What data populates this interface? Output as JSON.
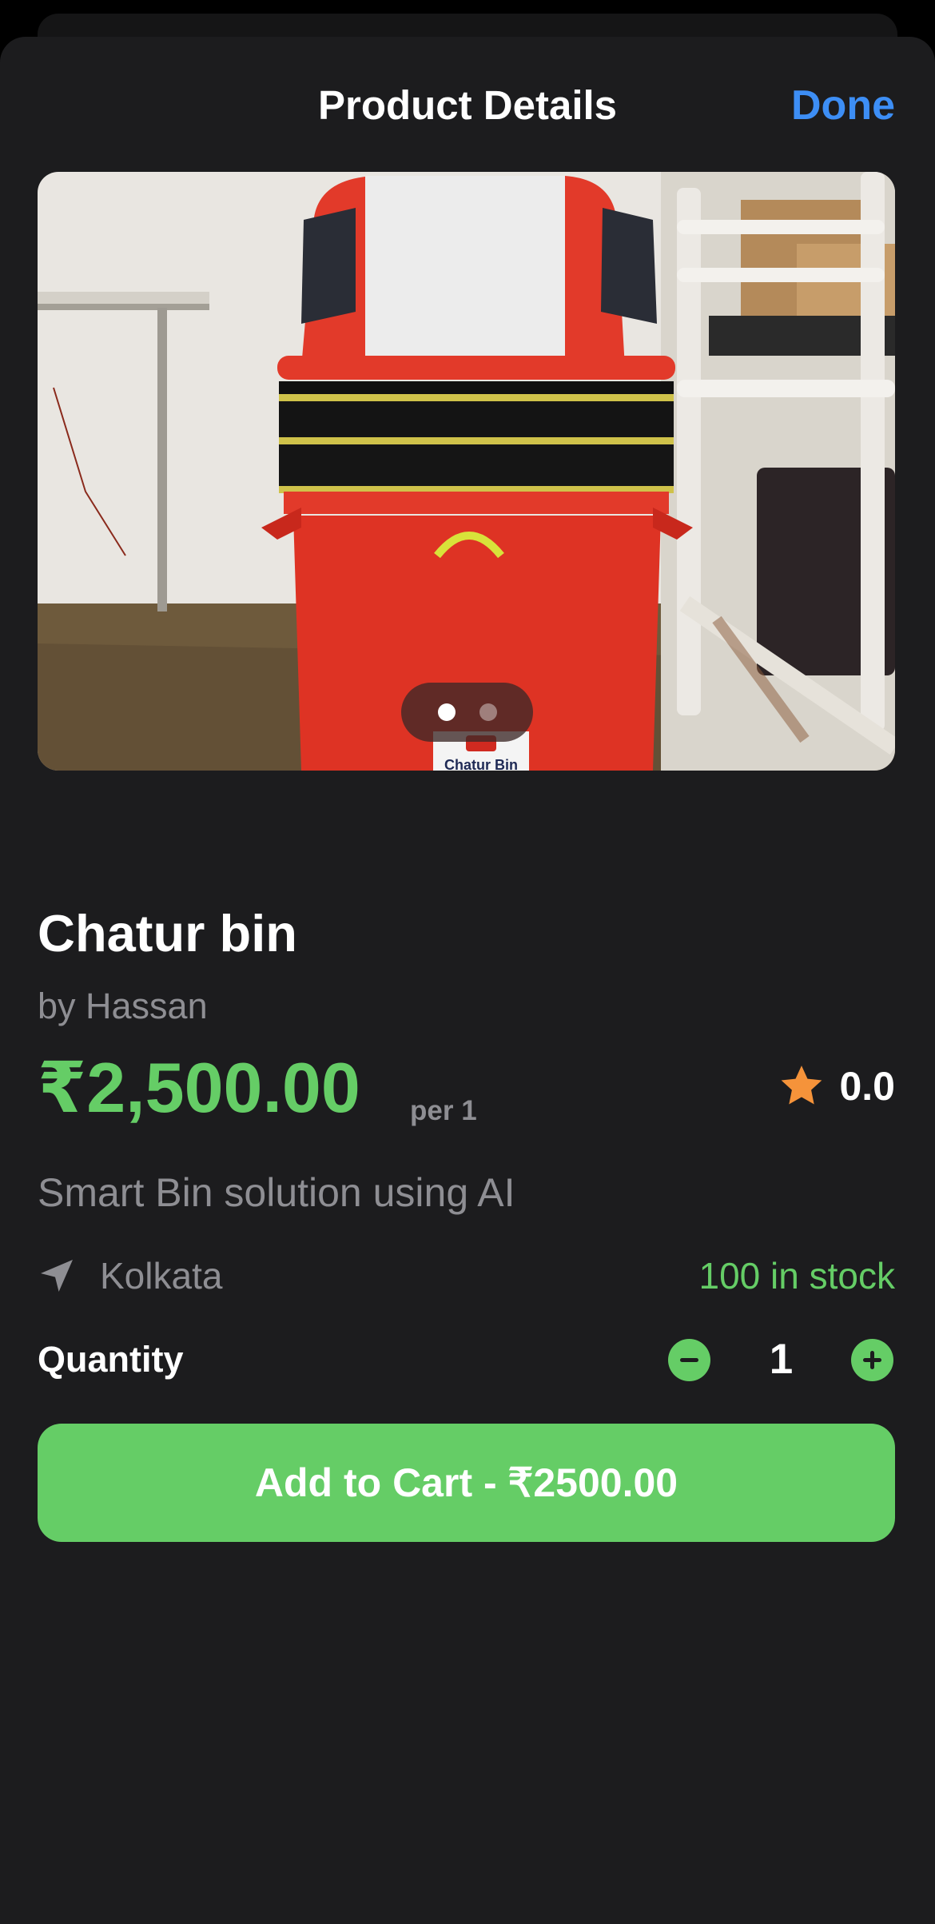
{
  "header": {
    "title": "Product Details",
    "done_label": "Done"
  },
  "gallery": {
    "page_count": 2,
    "current_page": 1,
    "photo_label_text": "Chatur Bin"
  },
  "product": {
    "name": "Chatur bin",
    "seller": "by Hassan",
    "price": "₹2,500.00",
    "unit": "per 1",
    "rating": "0.0",
    "description": "Smart Bin solution using AI",
    "location": "Kolkata",
    "stock": "100 in stock"
  },
  "quantity": {
    "label": "Quantity",
    "value": "1"
  },
  "actions": {
    "add_to_cart_label": "Add to Cart - ₹2500.00"
  },
  "icons": {
    "rating": "star-icon",
    "location": "location-arrow-icon",
    "decrease": "minus-circle-icon",
    "increase": "plus-circle-icon"
  },
  "colors": {
    "accent_green": "#65cd66",
    "link_blue": "#3d8ef5",
    "star_orange": "#f5933a",
    "sheet_background": "#1c1c1e",
    "secondary_text": "#8e8e93"
  }
}
